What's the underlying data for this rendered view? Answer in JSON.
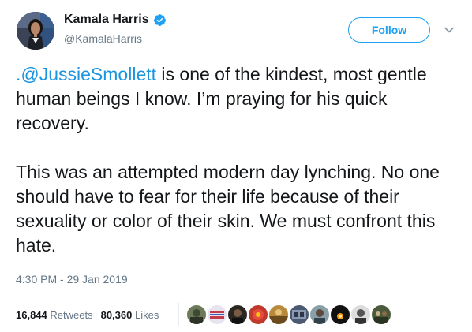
{
  "author": {
    "display_name": "Kamala Harris",
    "handle": "@KamalaHarris",
    "verified_icon": "verified-badge-icon"
  },
  "actions": {
    "follow_label": "Follow",
    "more_icon": "chevron-down-icon"
  },
  "tweet": {
    "mention": ".@JussieSmollett",
    "p1_rest": " is one of the kindest, most gentle human beings I know. I’m praying for his quick recovery.",
    "p2": "This was an attempted modern day lynching. No one should have to fear for their life because of their sexuality or color of their skin. We must confront this hate."
  },
  "timestamp": "4:30 PM - 29 Jan 2019",
  "stats": {
    "retweets_count": "16,844",
    "retweets_label": "Retweets",
    "likes_count": "80,360",
    "likes_label": "Likes"
  },
  "colors": {
    "link": "#1b95e0",
    "accent": "#1da1f2",
    "muted": "#657786"
  }
}
